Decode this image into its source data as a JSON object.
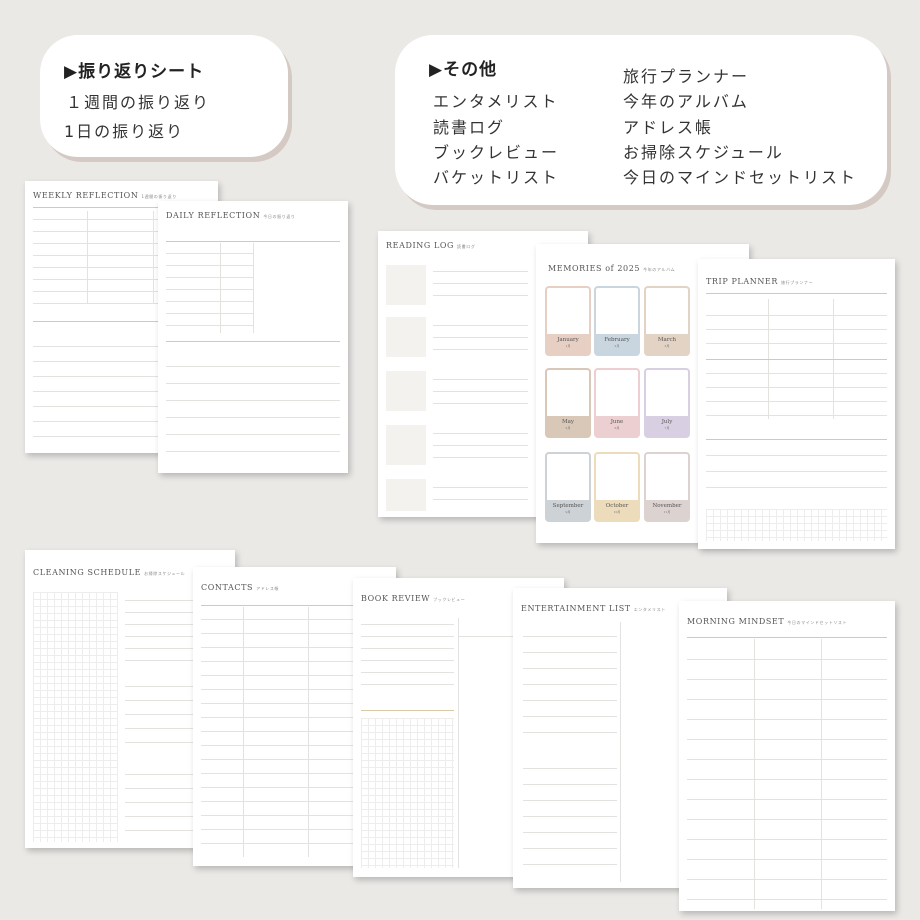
{
  "left_box": {
    "heading": "▶振り返りシート",
    "items": [
      "１週間の振り返り",
      "1日の振り返り"
    ]
  },
  "right_box": {
    "heading": "▶その他",
    "col1": [
      "エンタメリスト",
      "読書ログ",
      "ブックレビュー",
      "バケットリスト"
    ],
    "col2": [
      "旅行プランナー",
      "今年のアルバム",
      "アドレス帳",
      "お掃除スケジュール",
      "今日のマインドセットリスト"
    ]
  },
  "sheets": {
    "weekly": {
      "title": "WEEKLY REFLECTION",
      "sub": "1週間の振り返り"
    },
    "daily": {
      "title": "DAILY REFLECTION",
      "sub": "今日の振り返り"
    },
    "reading": {
      "title": "READING LOG",
      "sub": "読書ログ"
    },
    "memories": {
      "title": "MEMORIES of 2025",
      "sub": "今年のアルバム",
      "months": [
        {
          "name": "January",
          "num": "1月",
          "color": "#e8cfc4"
        },
        {
          "name": "February",
          "num": "2月",
          "color": "#c9d6df"
        },
        {
          "name": "March",
          "num": "3月",
          "color": "#e2d3c4"
        },
        {
          "name": "May",
          "num": "5月",
          "color": "#d9c8b8"
        },
        {
          "name": "June",
          "num": "6月",
          "color": "#ebcfd1"
        },
        {
          "name": "July",
          "num": "7月",
          "color": "#d8d0e2"
        },
        {
          "name": "September",
          "num": "9月",
          "color": "#ccd2d6"
        },
        {
          "name": "October",
          "num": "10月",
          "color": "#ecdcbc"
        },
        {
          "name": "November",
          "num": "11月",
          "color": "#dcd2d0"
        }
      ]
    },
    "trip": {
      "title": "TRIP PLANNER",
      "sub": "旅行プランナー"
    },
    "cleaning": {
      "title": "CLEANING SCHEDULE",
      "sub": "お掃除スケジュール"
    },
    "contacts": {
      "title": "CONTACTS",
      "sub": "アドレス帳"
    },
    "review": {
      "title": "BOOK REVIEW",
      "sub": "ブックレビュー"
    },
    "entertainment": {
      "title": "ENTERTAINMENT LIST",
      "sub": "エンタメリスト"
    },
    "mindset": {
      "title": "MORNING MINDSET",
      "sub": "今日のマインドセットリスト"
    }
  },
  "colors": {
    "background": "#ebe9e6",
    "bubble_shadow": "#d4c9c3",
    "accent_line": "#d9c9a8"
  }
}
